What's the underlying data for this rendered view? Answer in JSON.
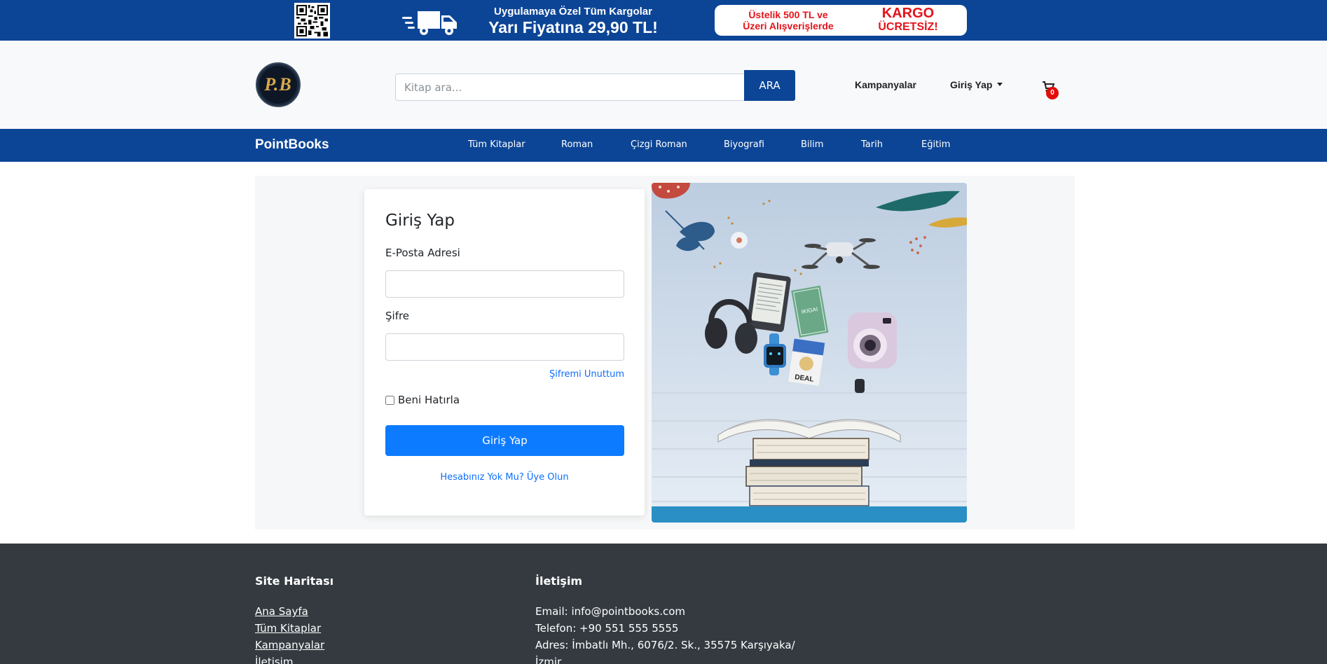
{
  "promo": {
    "line1": "Uygulamaya Özel Tüm Kargolar",
    "line2": "Yarı Fiyatına 29,90 TL!",
    "pill_left_1": "Üstelik 500 TL ve",
    "pill_left_2": "Üzeri Alışverişlerde",
    "pill_right_1": "KARGO",
    "pill_right_2": "ÜCRETSİZ!"
  },
  "header": {
    "logo_text": "P.B",
    "search_placeholder": "Kitap ara...",
    "search_button": "ARA",
    "campaigns": "Kampanyalar",
    "login": "Giriş Yap",
    "cart_count": "0"
  },
  "nav": {
    "brand": "PointBooks",
    "items": [
      "Tüm Kitaplar",
      "Roman",
      "Çizgi Roman",
      "Biyografi",
      "Bilim",
      "Tarih",
      "Eğitim"
    ]
  },
  "login_form": {
    "title": "Giriş Yap",
    "email_label": "E-Posta Adresi",
    "password_label": "Şifre",
    "forgot": "Şifremi Unuttum",
    "remember": "Beni Hatırla",
    "submit": "Giriş Yap",
    "register": "Hesabınız Yok Mu? Üye Olun"
  },
  "hero": {
    "book_text": "IKIGAI",
    "game_text": "DEAL"
  },
  "footer": {
    "sitemap_title": "Site Haritası",
    "links": [
      "Ana Sayfa",
      "Tüm Kitaplar",
      "Kampanyalar",
      "İletişim"
    ],
    "contact_title": "İletişim",
    "email": "Email: info@pointbooks.com",
    "phone": "Telefon: +90 551 555 5555",
    "address_1": "Adres: İmbatlı Mh., 6076/2. Sk., 35575 Karşıyaka/",
    "address_2": "İzmir"
  },
  "colors": {
    "brand_blue": "#0c4596",
    "primary": "#0d7bff",
    "footer_bg": "#343a40",
    "badge_red": "#e30d0d"
  },
  "icons": [
    "qr-code-icon",
    "truck-icon",
    "cart-icon",
    "caret-down-icon"
  ]
}
